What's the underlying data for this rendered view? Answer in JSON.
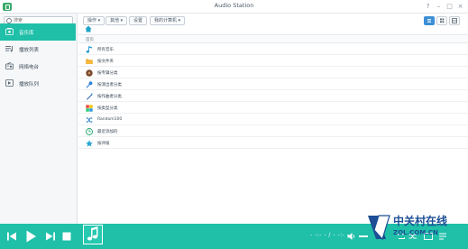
{
  "window": {
    "title": "Audio Station",
    "help": "?",
    "minimize": "–",
    "maximize": "□",
    "close": "×"
  },
  "sidebar": {
    "search_placeholder": "搜索",
    "items": [
      {
        "label": "音乐库",
        "icon": "music-library-icon",
        "active": true
      },
      {
        "label": "播放列表",
        "icon": "playlist-icon",
        "active": false
      },
      {
        "label": "网络电台",
        "icon": "radio-icon",
        "active": false
      },
      {
        "label": "播放队列",
        "icon": "queue-icon",
        "active": false
      }
    ]
  },
  "toolbar": {
    "action_label": "操作 ▾",
    "more_label": "其他 ▾",
    "settings_label": "设置",
    "dlna_label": "我的计算机 ▾"
  },
  "breadcrumb": {
    "label": "首页"
  },
  "library": {
    "items": [
      {
        "label": "所有音乐",
        "icon": "music-note-icon"
      },
      {
        "label": "按文件夹",
        "icon": "folder-icon"
      },
      {
        "label": "按专辑分类",
        "icon": "album-icon"
      },
      {
        "label": "按演出者分类",
        "icon": "microphone-icon"
      },
      {
        "label": "按作曲者分类",
        "icon": "composer-icon"
      },
      {
        "label": "按类型分类",
        "icon": "genre-icon"
      },
      {
        "label": "Random100",
        "icon": "shuffle-icon"
      },
      {
        "label": "最近添加的",
        "icon": "clock-icon"
      },
      {
        "label": "按评级",
        "icon": "star-icon"
      }
    ]
  },
  "player": {
    "time": "- -:- -  /  - -:- -"
  },
  "watermark": {
    "title": "中关村在线",
    "url": "ZOL.COM.CN"
  },
  "colors": {
    "accent": "#1fbfa8",
    "view_active": "#3d8fd6",
    "watermark": "#1c4f95"
  }
}
